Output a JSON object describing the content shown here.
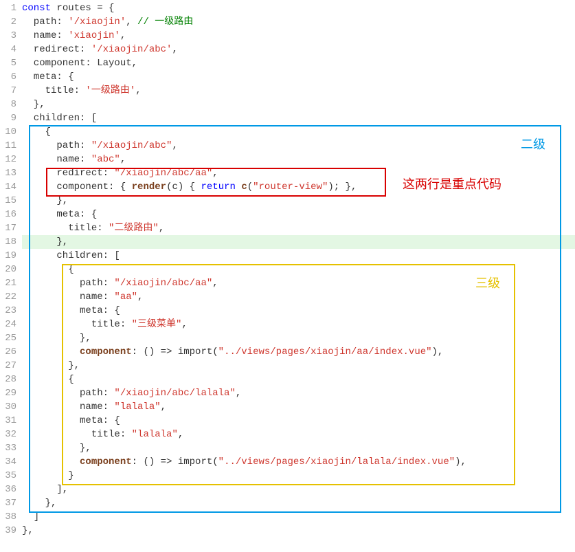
{
  "labels": {
    "blue": "二级",
    "red": "这两行是重点代码",
    "yellow": "三级"
  },
  "lines": [
    {
      "n": 1,
      "seg": [
        [
          "kw",
          "const"
        ],
        [
          "nm",
          " routes = {"
        ]
      ]
    },
    {
      "n": 2,
      "seg": [
        [
          "nm",
          "  path: "
        ],
        [
          "str",
          "'/xiaojin'"
        ],
        [
          "nm",
          ", "
        ],
        [
          "cm",
          "// 一级路由"
        ]
      ]
    },
    {
      "n": 3,
      "seg": [
        [
          "nm",
          "  name: "
        ],
        [
          "str",
          "'xiaojin'"
        ],
        [
          "nm",
          ","
        ]
      ]
    },
    {
      "n": 4,
      "seg": [
        [
          "nm",
          "  redirect: "
        ],
        [
          "str",
          "'/xiaojin/abc'"
        ],
        [
          "nm",
          ","
        ]
      ]
    },
    {
      "n": 5,
      "seg": [
        [
          "nm",
          "  component: Layout,"
        ]
      ]
    },
    {
      "n": 6,
      "seg": [
        [
          "nm",
          "  meta: {"
        ]
      ]
    },
    {
      "n": 7,
      "seg": [
        [
          "nm",
          "    title: "
        ],
        [
          "str",
          "'一级路由'"
        ],
        [
          "nm",
          ","
        ]
      ]
    },
    {
      "n": 8,
      "seg": [
        [
          "nm",
          "  },"
        ]
      ]
    },
    {
      "n": 9,
      "seg": [
        [
          "nm",
          "  children: ["
        ]
      ]
    },
    {
      "n": 10,
      "seg": [
        [
          "nm",
          "    {"
        ]
      ]
    },
    {
      "n": 11,
      "seg": [
        [
          "nm",
          "      path: "
        ],
        [
          "str",
          "\"/xiaojin/abc\""
        ],
        [
          "nm",
          ","
        ]
      ]
    },
    {
      "n": 12,
      "seg": [
        [
          "nm",
          "      name: "
        ],
        [
          "str",
          "\"abc\""
        ],
        [
          "nm",
          ","
        ]
      ]
    },
    {
      "n": 13,
      "seg": [
        [
          "nm",
          "      redirect: "
        ],
        [
          "str",
          "\"/xiaojin/abc/aa\""
        ],
        [
          "nm",
          ","
        ]
      ]
    },
    {
      "n": 14,
      "seg": [
        [
          "nm",
          "      component: { "
        ],
        [
          "fn",
          "render"
        ],
        [
          "nm",
          "(c) { "
        ],
        [
          "kw",
          "return"
        ],
        [
          "nm",
          " "
        ],
        [
          "fn",
          "c"
        ],
        [
          "nm",
          "("
        ],
        [
          "str",
          "\"router-view\""
        ],
        [
          "nm",
          "); },"
        ]
      ]
    },
    {
      "n": 15,
      "seg": [
        [
          "nm",
          "      },"
        ]
      ]
    },
    {
      "n": 16,
      "seg": [
        [
          "nm",
          "      meta: {"
        ]
      ]
    },
    {
      "n": 17,
      "seg": [
        [
          "nm",
          "        title: "
        ],
        [
          "str",
          "\"二级路由\""
        ],
        [
          "nm",
          ","
        ]
      ]
    },
    {
      "n": 18,
      "hl": true,
      "seg": [
        [
          "nm",
          "      },"
        ]
      ]
    },
    {
      "n": 19,
      "seg": [
        [
          "nm",
          "      children: ["
        ]
      ]
    },
    {
      "n": 20,
      "seg": [
        [
          "nm",
          "        {"
        ]
      ]
    },
    {
      "n": 21,
      "seg": [
        [
          "nm",
          "          path: "
        ],
        [
          "str",
          "\"/xiaojin/abc/aa\""
        ],
        [
          "nm",
          ","
        ]
      ]
    },
    {
      "n": 22,
      "seg": [
        [
          "nm",
          "          name: "
        ],
        [
          "str",
          "\"aa\""
        ],
        [
          "nm",
          ","
        ]
      ]
    },
    {
      "n": 23,
      "seg": [
        [
          "nm",
          "          meta: {"
        ]
      ]
    },
    {
      "n": 24,
      "seg": [
        [
          "nm",
          "            title: "
        ],
        [
          "str",
          "\"三级菜单\""
        ],
        [
          "nm",
          ","
        ]
      ]
    },
    {
      "n": 25,
      "seg": [
        [
          "nm",
          "          },"
        ]
      ]
    },
    {
      "n": 26,
      "seg": [
        [
          "nm",
          "          "
        ],
        [
          "fn",
          "component"
        ],
        [
          "nm",
          ": () => import("
        ],
        [
          "str",
          "\"../views/pages/xiaojin/aa/index.vue\""
        ],
        [
          "nm",
          "),"
        ]
      ]
    },
    {
      "n": 27,
      "seg": [
        [
          "nm",
          "        },"
        ]
      ]
    },
    {
      "n": 28,
      "seg": [
        [
          "nm",
          "        {"
        ]
      ]
    },
    {
      "n": 29,
      "seg": [
        [
          "nm",
          "          path: "
        ],
        [
          "str",
          "\"/xiaojin/abc/lalala\""
        ],
        [
          "nm",
          ","
        ]
      ]
    },
    {
      "n": 30,
      "seg": [
        [
          "nm",
          "          name: "
        ],
        [
          "str",
          "\"lalala\""
        ],
        [
          "nm",
          ","
        ]
      ]
    },
    {
      "n": 31,
      "seg": [
        [
          "nm",
          "          meta: {"
        ]
      ]
    },
    {
      "n": 32,
      "seg": [
        [
          "nm",
          "            title: "
        ],
        [
          "str",
          "\"lalala\""
        ],
        [
          "nm",
          ","
        ]
      ]
    },
    {
      "n": 33,
      "seg": [
        [
          "nm",
          "          },"
        ]
      ]
    },
    {
      "n": 34,
      "seg": [
        [
          "nm",
          "          "
        ],
        [
          "fn",
          "component"
        ],
        [
          "nm",
          ": () => import("
        ],
        [
          "str",
          "\"../views/pages/xiaojin/lalala/index.vue\""
        ],
        [
          "nm",
          "),"
        ]
      ]
    },
    {
      "n": 35,
      "seg": [
        [
          "nm",
          "        }"
        ]
      ]
    },
    {
      "n": 36,
      "seg": [
        [
          "nm",
          "      ],"
        ]
      ]
    },
    {
      "n": 37,
      "seg": [
        [
          "nm",
          "    },"
        ]
      ]
    },
    {
      "n": 38,
      "seg": [
        [
          "nm",
          "  ]"
        ]
      ]
    },
    {
      "n": 39,
      "seg": [
        [
          "nm",
          "},"
        ]
      ]
    }
  ]
}
